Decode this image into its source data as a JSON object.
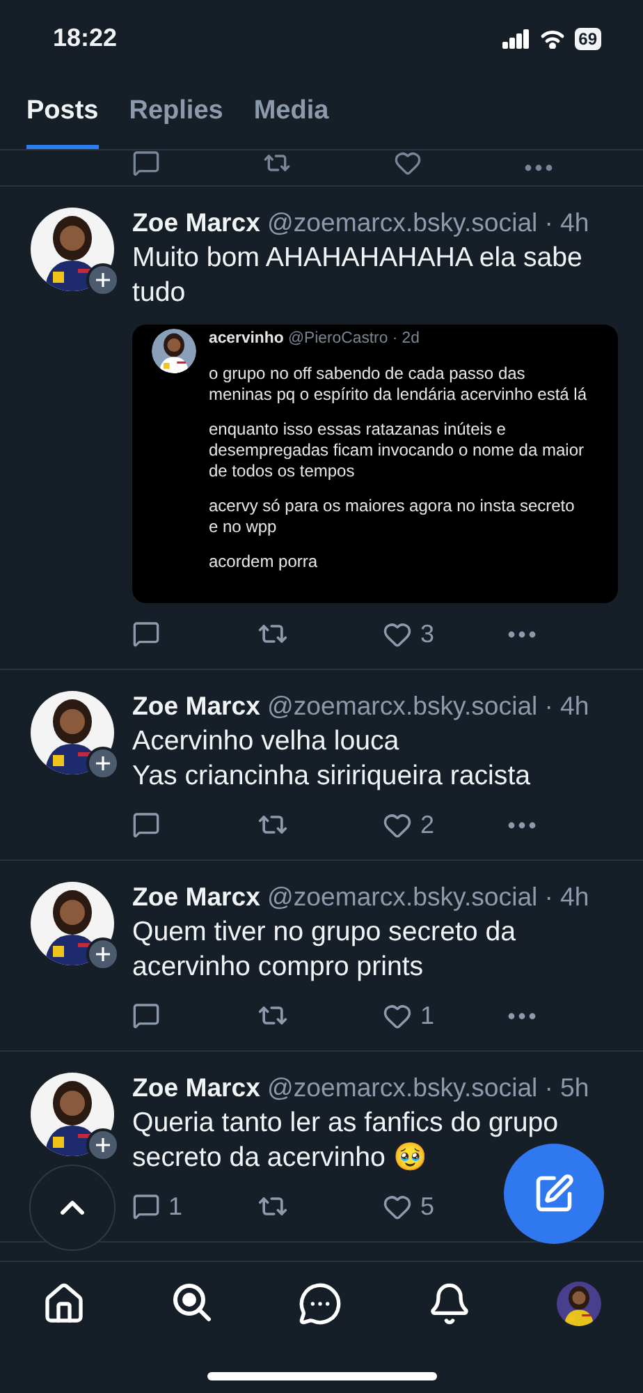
{
  "status_bar": {
    "time": "18:22",
    "battery": "69"
  },
  "tabs": [
    {
      "label": "Posts",
      "selected": true
    },
    {
      "label": "Replies",
      "selected": false
    },
    {
      "label": "Media",
      "selected": false
    }
  ],
  "posts": [
    {
      "author": "Zoe Marcx",
      "handle": "@zoemarcx.bsky.social",
      "time": "· 4h",
      "text": "Muito bom AHAHAHAHAHA ela sabe tudo",
      "embed": {
        "author": "acervinho",
        "handle": "@PieroCastro · 2d",
        "paragraphs": [
          "o grupo no off sabendo de cada passo das meninas pq o espírito da lendária acervinho está lá",
          "enquanto isso essas ratazanas inúteis e desempregadas ficam invocando o nome da maior de todos os tempos",
          "acervy só para os maiores agora no insta secreto e no wpp",
          "acordem porra"
        ]
      },
      "like_count": "3"
    },
    {
      "author": "Zoe Marcx",
      "handle": "@zoemarcx.bsky.social",
      "time": "· 4h",
      "text": "Acervinho velha louca\nYas criancinha siririqueira racista",
      "like_count": "2"
    },
    {
      "author": "Zoe Marcx",
      "handle": "@zoemarcx.bsky.social",
      "time": "· 4h",
      "text": "Quem tiver no grupo secreto da acervinho compro prints",
      "like_count": "1"
    },
    {
      "author": "Zoe Marcx",
      "handle": "@zoemarcx.bsky.social",
      "time": "· 5h",
      "text": "Queria tanto ler as fanfics do grupo secreto da acervinho 🥹",
      "reply_count": "1",
      "like_count": "5"
    }
  ],
  "nav": [
    {
      "kind": "home"
    },
    {
      "kind": "search"
    },
    {
      "kind": "chat"
    },
    {
      "kind": "bell"
    },
    {
      "kind": "avatar"
    }
  ]
}
